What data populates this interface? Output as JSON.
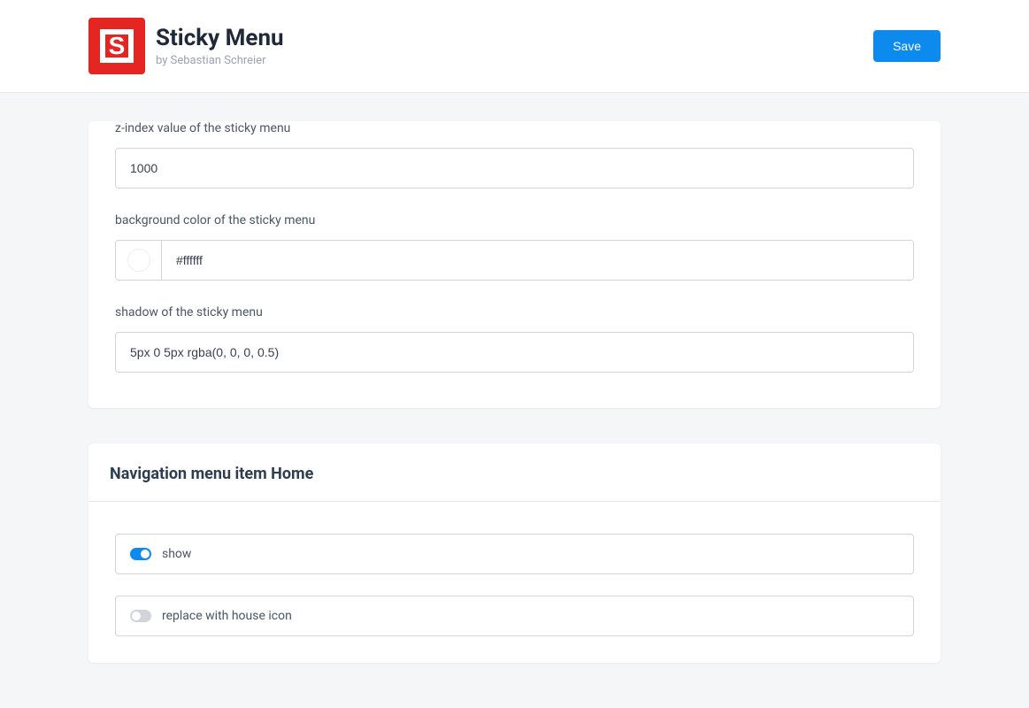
{
  "header": {
    "title": "Sticky Menu",
    "subtitle": "by Sebastian Schreier",
    "save_label": "Save"
  },
  "settings": {
    "zindex": {
      "label": "z-index value of the sticky menu",
      "value": "1000"
    },
    "bgcolor": {
      "label": "background color of the sticky menu",
      "value": "#ffffff"
    },
    "shadow": {
      "label": "shadow of the sticky menu",
      "value": "5px 0 5px rgba(0, 0, 0, 0.5)"
    }
  },
  "nav_home": {
    "section_title": "Navigation menu item Home",
    "show": {
      "label": "show",
      "enabled": true
    },
    "house_icon": {
      "label": "replace with house icon",
      "enabled": false
    }
  }
}
